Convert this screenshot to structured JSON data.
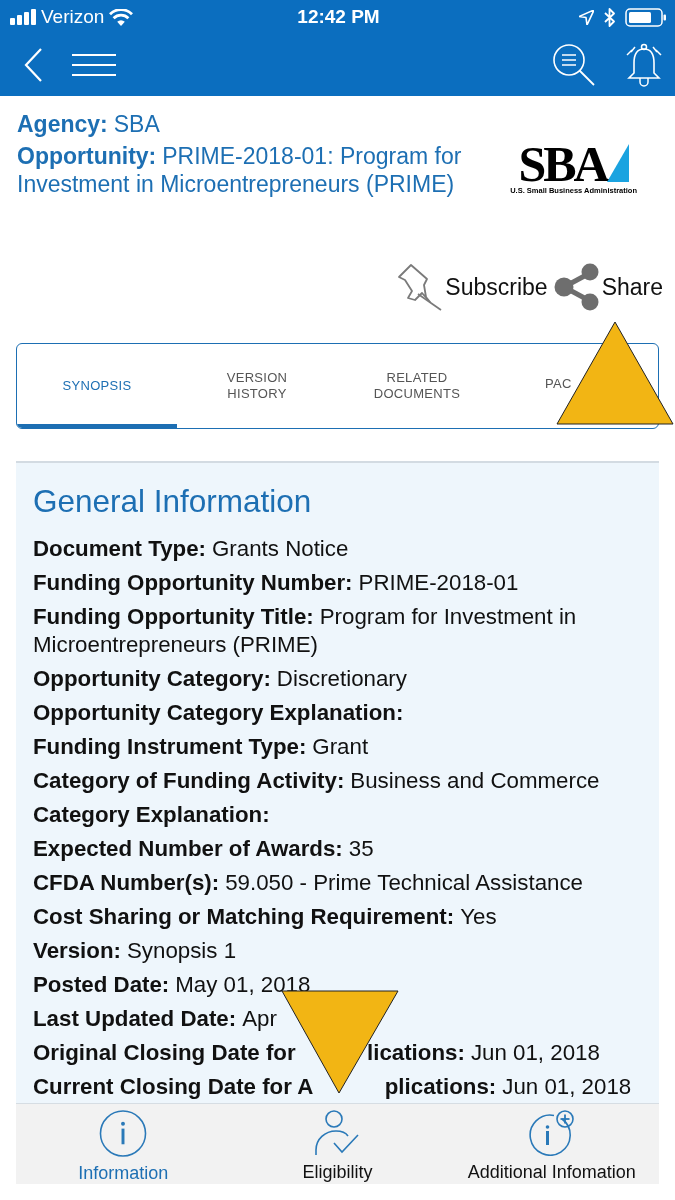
{
  "status_bar": {
    "carrier": "Verizon",
    "time": "12:42 PM"
  },
  "header": {
    "agency_label": "Agency:",
    "agency": "SBA",
    "opportunity_label": "Opportunity:",
    "opportunity": "PRIME-2018-01: Program for Investment in Microentrepreneurs (PRIME)",
    "logo": {
      "wordmark": "SBA",
      "tagline": "U.S. Small Business Administration"
    }
  },
  "actions": [
    {
      "kind": "subscribe",
      "label": "Subscribe"
    },
    {
      "kind": "share",
      "label": "Share"
    }
  ],
  "tabs": [
    {
      "label": "SYNOPSIS",
      "selected": true
    },
    {
      "label": "VERSION HISTORY",
      "selected": false
    },
    {
      "label": "RELATED DOCUMENTS",
      "selected": false
    },
    {
      "label": "PAC",
      "selected": false
    }
  ],
  "section": {
    "title": "General Information",
    "fields": [
      {
        "label": "Document Type:",
        "value": "Grants Notice"
      },
      {
        "label": "Funding Opportunity Number:",
        "value": "PRIME-2018-01"
      },
      {
        "label": "Funding Opportunity Title:",
        "value": "Program for Investment in Microentrepreneurs (PRIME)"
      },
      {
        "label": "Opportunity Category:",
        "value": "Discretionary"
      },
      {
        "label": "Opportunity Category Explanation:"
      },
      {
        "label": "Funding Instrument Type:",
        "value": "Grant"
      },
      {
        "label": "Category of Funding Activity:",
        "value": "Business and Commerce"
      },
      {
        "label": "Category Explanation:"
      },
      {
        "label": "Expected Number of Awards:",
        "value": "35"
      },
      {
        "label": "CFDA Number(s):",
        "value": "59.050 - Prime Technical Assistance"
      },
      {
        "label": "Cost Sharing or Matching Requirement:",
        "value": "Yes"
      },
      {
        "label": "Version:",
        "value": "Synopsis 1"
      },
      {
        "label": "Posted Date:",
        "value": "May 01, 2018"
      },
      {
        "label": "Last Updated Date:",
        "value": "Apr"
      },
      {
        "label_parts": [
          "Original Closing Date for",
          "lications:"
        ],
        "value": "Jun 01, 2018"
      },
      {
        "label_parts": [
          "Current Closing Date for A",
          "plications:"
        ],
        "value": "Jun 01, 2018"
      }
    ]
  },
  "bottom_tabs": [
    {
      "kind": "info",
      "label": "Information",
      "selected": true
    },
    {
      "kind": "eligibility",
      "label": "Eligibility",
      "selected": false
    },
    {
      "kind": "info-plus",
      "label": "Additional Infomation",
      "selected": false
    }
  ]
}
